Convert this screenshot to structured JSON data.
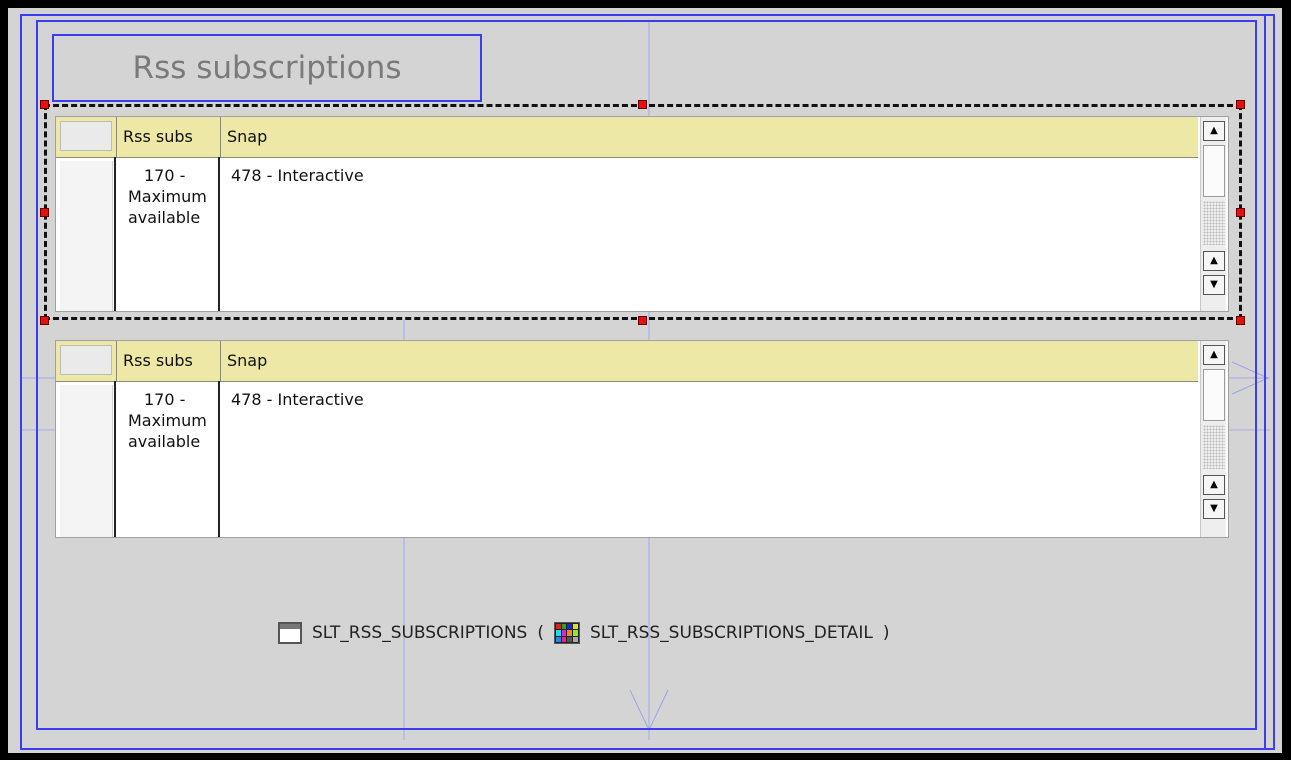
{
  "form": {
    "title": "Rss subscriptions"
  },
  "grids": [
    {
      "columns": [
        "Rss subs",
        "Snap"
      ],
      "rows": [
        {
          "col1_lines": [
            "170 -",
            "Maximum",
            "available"
          ],
          "col2": "478 - Interactive"
        }
      ]
    },
    {
      "columns": [
        "Rss subs",
        "Snap"
      ],
      "rows": [
        {
          "col1_lines": [
            "170 -",
            "Maximum",
            "available"
          ],
          "col2": "478 - Interactive"
        }
      ]
    }
  ],
  "footer": {
    "table_name": "SLT_RSS_SUBSCRIPTIONS",
    "open_paren": "(",
    "detail_name": "SLT_RSS_SUBSCRIPTIONS_DETAIL",
    "close_paren": ")",
    "table_icon": "table-icon",
    "detail_icon": "grid-detail-icon"
  },
  "colors": {
    "border_blue": "#3c3cf0",
    "header_yellow": "#ede8a6",
    "handle_red": "#e41111",
    "background_gray": "#d4d4d4"
  }
}
